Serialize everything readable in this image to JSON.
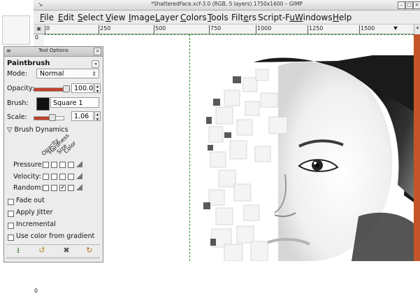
{
  "window": {
    "title": "*ShatteredFace.xcf-3.0 (RGB, 5 layers) 1750x1600 – GIMP",
    "controls": [
      "–",
      "□",
      "×"
    ]
  },
  "menubar": {
    "items": [
      {
        "first": "F",
        "rest": "ile"
      },
      {
        "first": "E",
        "rest": "dit"
      },
      {
        "first": "S",
        "rest": "elect"
      },
      {
        "first": "V",
        "rest": "iew"
      },
      {
        "first": "I",
        "rest": "mage"
      },
      {
        "first": "L",
        "rest": "ayer"
      },
      {
        "first": "C",
        "rest": "olors"
      },
      {
        "first": "T",
        "rest": "ools"
      },
      {
        "pre": "Filt",
        "first": "e",
        "rest": "rs"
      },
      {
        "pre": "Script-F",
        "first": "u",
        "rest": ""
      },
      {
        "first": "W",
        "rest": "indows"
      },
      {
        "first": "H",
        "rest": "elp"
      }
    ]
  },
  "ruler": {
    "h_labels": [
      "0",
      "250",
      "500",
      "750",
      "1000",
      "1250",
      "1500"
    ],
    "v_labels": [
      "0",
      "0"
    ]
  },
  "dock": {
    "title": "Tool Options",
    "tool_name": "Paintbrush",
    "mode": {
      "label": "Mode:",
      "value": "Normal"
    },
    "opacity": {
      "label": "Opacity:",
      "value": "100.0",
      "fraction": 1.0
    },
    "brush": {
      "label": "Brush:",
      "value": "Square 1"
    },
    "scale": {
      "label": "Scale:",
      "value": "1.06",
      "fraction": 0.53
    },
    "dynamics": {
      "heading": "Brush Dynamics",
      "columns": [
        "Opacity",
        "Hardness",
        "Size",
        "Color"
      ],
      "rows": [
        {
          "label": "Pressure:",
          "checks": [
            false,
            false,
            false,
            false
          ]
        },
        {
          "label": "Velocity:",
          "checks": [
            false,
            false,
            false,
            false
          ]
        },
        {
          "label": "Random:",
          "checks": [
            false,
            false,
            true,
            false
          ]
        }
      ]
    },
    "options": [
      {
        "label": "Fade out",
        "checked": false
      },
      {
        "label": "Apply Jitter",
        "checked": false
      },
      {
        "label": "Incremental",
        "checked": false
      },
      {
        "label": "Use color from gradient",
        "checked": false
      }
    ]
  },
  "colors": {
    "accent_slider": "#c0402c",
    "guide": "#2e8b2e",
    "orange_strip": "#c4552a"
  }
}
